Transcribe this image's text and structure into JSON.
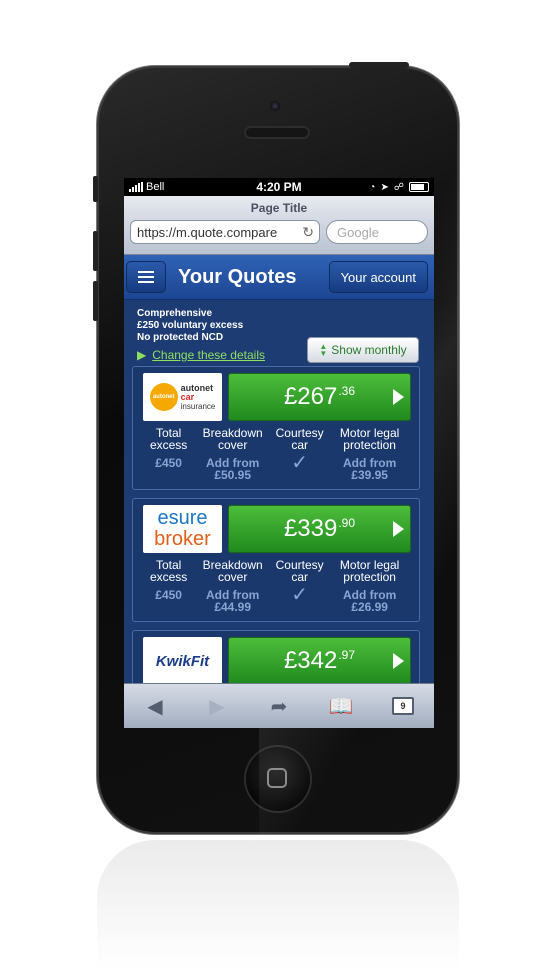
{
  "status_bar": {
    "carrier": "Bell",
    "time": "4:20 PM"
  },
  "browser": {
    "page_title": "Page Title",
    "url": "https://m.quote.compare",
    "search_placeholder": "Google",
    "tab_count": "9"
  },
  "header": {
    "title": "Your Quotes",
    "account_label": "Your account"
  },
  "summary": {
    "lines": [
      "Comprehensive",
      "£250 voluntary excess",
      "No protected NCD"
    ],
    "change_link": "Change these details",
    "monthly_button": "Show monthly"
  },
  "feature_labels": {
    "excess": [
      "Total",
      "excess"
    ],
    "breakdown": [
      "Breakdown",
      "cover"
    ],
    "courtesy": [
      "Courtesy",
      "car"
    ],
    "legal": [
      "Motor legal",
      "protection"
    ]
  },
  "quotes": [
    {
      "provider": "autonet car insurance",
      "logo": {
        "badge": "autonet",
        "line1": "autonet",
        "line2": "car",
        "line3": "insurance"
      },
      "price_main": "£267",
      "price_pence": ".36",
      "excess": "£450",
      "breakdown": [
        "Add from",
        "£50.95"
      ],
      "courtesy": "included",
      "legal": [
        "Add from",
        "£39.95"
      ]
    },
    {
      "provider": "esure broker",
      "logo": {
        "line1": "esure",
        "line2": "broker"
      },
      "price_main": "£339",
      "price_pence": ".90",
      "excess": "£450",
      "breakdown": [
        "Add from",
        "£44.99"
      ],
      "courtesy": "included",
      "legal": [
        "Add from",
        "£26.99"
      ]
    },
    {
      "provider": "KwikFit",
      "logo": {
        "line1": "KwikFit"
      },
      "price_main": "£342",
      "price_pence": ".97"
    }
  ],
  "colors": {
    "price_green": "#3aa52f",
    "header_blue": "#2f62b5",
    "link_green": "#8fe05d"
  }
}
